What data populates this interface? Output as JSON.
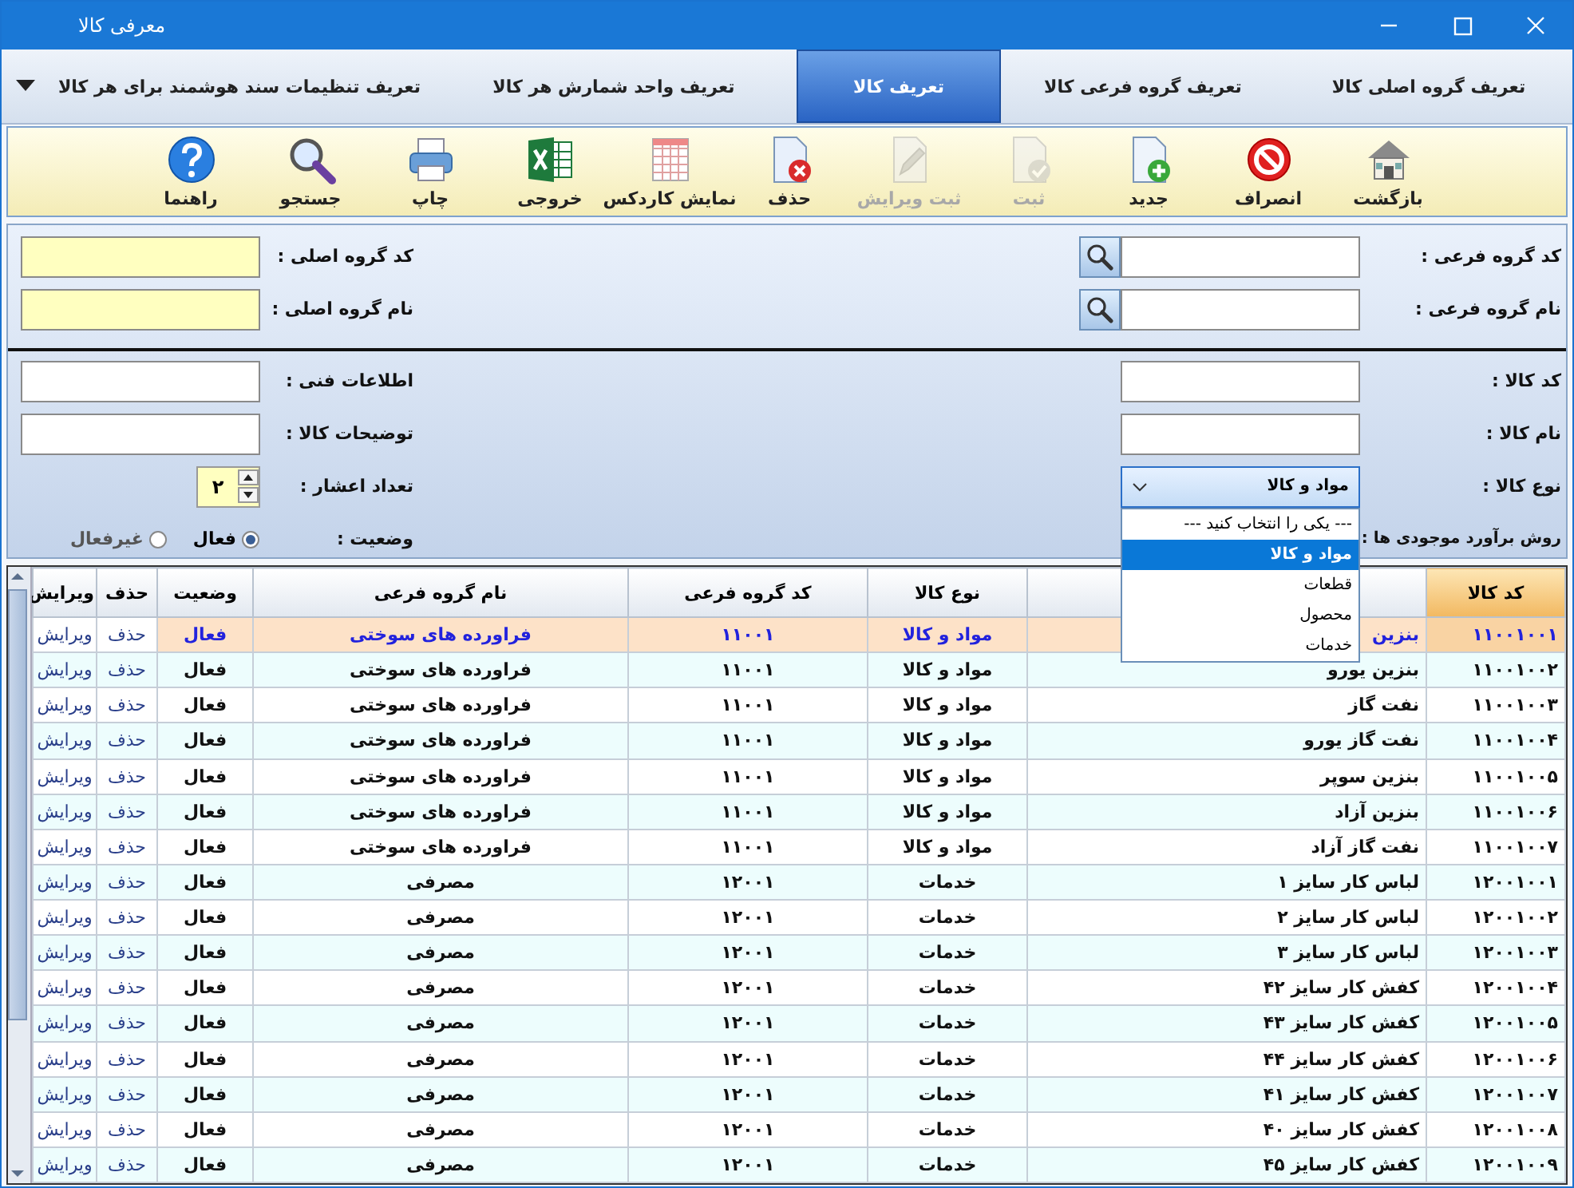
{
  "window": {
    "title": "معرفی کالا"
  },
  "tabs": [
    {
      "label": "تعریف گروه اصلی کالا",
      "selected": false
    },
    {
      "label": "تعریف گروه فرعی کالا",
      "selected": false
    },
    {
      "label": "تعریف کالا",
      "selected": true
    },
    {
      "label": "تعریف واحد شمارش هر کالا",
      "selected": false
    },
    {
      "label": "تعریف تنظیمات سند هوشمند برای هر کالا",
      "selected": false
    }
  ],
  "toolbar": [
    {
      "label": "بازگشت",
      "disabled": false
    },
    {
      "label": "انصراف",
      "disabled": false
    },
    {
      "label": "جدید",
      "disabled": false
    },
    {
      "label": "ثبت",
      "disabled": true
    },
    {
      "label": "ثبت ویرایش",
      "disabled": true
    },
    {
      "label": "حذف",
      "disabled": false
    },
    {
      "label": "نمایش کاردکس",
      "disabled": false
    },
    {
      "label": "خروجی",
      "disabled": false
    },
    {
      "label": "چاپ",
      "disabled": false
    },
    {
      "label": "جستجو",
      "disabled": false
    },
    {
      "label": "راهنما",
      "disabled": false
    }
  ],
  "group_section": {
    "sub_group": [
      {
        "label": "کد گروه فرعی :"
      },
      {
        "label": "نام گروه فرعی :"
      }
    ],
    "main_group": [
      {
        "label": "کد گروه اصلی :"
      },
      {
        "label": "نام گروه اصلی :"
      }
    ]
  },
  "item_section": {
    "right": [
      {
        "kind": "text",
        "label": "کد کالا :"
      },
      {
        "kind": "text",
        "label": "نام کالا :"
      },
      {
        "kind": "select",
        "label": "نوع کالا :",
        "value": "مواد و کالا",
        "expanded": true,
        "options": [
          {
            "label": "--- یکی را انتخاب کنید ---",
            "selected": false
          },
          {
            "label": "مواد و کالا",
            "selected": true
          },
          {
            "label": "قطعات",
            "selected": false
          },
          {
            "label": "محصول",
            "selected": false
          },
          {
            "label": "خدمات",
            "selected": false
          }
        ]
      },
      {
        "kind": "label",
        "label": "روش برآورد موجودی ها :"
      }
    ],
    "left": [
      {
        "kind": "text",
        "label": "اطلاعات فنی :"
      },
      {
        "kind": "text",
        "label": "توضیحات کالا :"
      },
      {
        "kind": "spinner",
        "label": "تعداد اعشار :",
        "value": "۲"
      },
      {
        "kind": "radio",
        "label": "وضعیت :",
        "options": [
          {
            "label": "فعال",
            "selected": true
          },
          {
            "label": "غیرفعال",
            "selected": false
          }
        ]
      }
    ]
  },
  "table": {
    "columns": [
      {
        "label": "کد کالا",
        "sorted": true
      },
      {
        "sorted": false
      },
      {
        "label": "نوع کالا",
        "sorted": false
      },
      {
        "label": "کد گروه فرعی",
        "sorted": false
      },
      {
        "label": "نام گروه فرعی",
        "sorted": false
      },
      {
        "label": "وضعیت",
        "sorted": false
      },
      {
        "label": "حذف",
        "sorted": false
      },
      {
        "label": "ویرایش",
        "sorted": false
      }
    ],
    "rows": [
      {
        "code": "۱۱۰۰۱۰۰۱",
        "name": "بنزین",
        "type": "مواد و کالا",
        "sub_code": "۱۱۰۰۱",
        "sub_name": "فراورده های سوختی",
        "status": "فعال",
        "delete": "حذف",
        "edit": "ویرایش",
        "selected": true
      },
      {
        "code": "۱۱۰۰۱۰۰۲",
        "name": "بنزین یورو",
        "type": "مواد و کالا",
        "sub_code": "۱۱۰۰۱",
        "sub_name": "فراورده های سوختی",
        "status": "فعال",
        "delete": "حذف",
        "edit": "ویرایش",
        "selected": false
      },
      {
        "code": "۱۱۰۰۱۰۰۳",
        "name": "نفت گاز",
        "type": "مواد و کالا",
        "sub_code": "۱۱۰۰۱",
        "sub_name": "فراورده های سوختی",
        "status": "فعال",
        "delete": "حذف",
        "edit": "ویرایش",
        "selected": false
      },
      {
        "code": "۱۱۰۰۱۰۰۴",
        "name": "نفت گاز یورو",
        "type": "مواد و کالا",
        "sub_code": "۱۱۰۰۱",
        "sub_name": "فراورده های سوختی",
        "status": "فعال",
        "delete": "حذف",
        "edit": "ویرایش",
        "selected": false
      },
      {
        "code": "۱۱۰۰۱۰۰۵",
        "name": "بنزین سوپر",
        "type": "مواد و کالا",
        "sub_code": "۱۱۰۰۱",
        "sub_name": "فراورده های سوختی",
        "status": "فعال",
        "delete": "حذف",
        "edit": "ویرایش",
        "selected": false
      },
      {
        "code": "۱۱۰۰۱۰۰۶",
        "name": "بنزین آزاد",
        "type": "مواد و کالا",
        "sub_code": "۱۱۰۰۱",
        "sub_name": "فراورده های سوختی",
        "status": "فعال",
        "delete": "حذف",
        "edit": "ویرایش",
        "selected": false
      },
      {
        "code": "۱۱۰۰۱۰۰۷",
        "name": "نفت گاز آزاد",
        "type": "مواد و کالا",
        "sub_code": "۱۱۰۰۱",
        "sub_name": "فراورده های سوختی",
        "status": "فعال",
        "delete": "حذف",
        "edit": "ویرایش",
        "selected": false
      },
      {
        "code": "۱۲۰۰۱۰۰۱",
        "name": "لباس کار سایز ۱",
        "type": "خدمات",
        "sub_code": "۱۲۰۰۱",
        "sub_name": "مصرفی",
        "status": "فعال",
        "delete": "حذف",
        "edit": "ویرایش",
        "selected": false
      },
      {
        "code": "۱۲۰۰۱۰۰۲",
        "name": "لباس کار سایز ۲",
        "type": "خدمات",
        "sub_code": "۱۲۰۰۱",
        "sub_name": "مصرفی",
        "status": "فعال",
        "delete": "حذف",
        "edit": "ویرایش",
        "selected": false
      },
      {
        "code": "۱۲۰۰۱۰۰۳",
        "name": "لباس کار سایز ۳",
        "type": "خدمات",
        "sub_code": "۱۲۰۰۱",
        "sub_name": "مصرفی",
        "status": "فعال",
        "delete": "حذف",
        "edit": "ویرایش",
        "selected": false
      },
      {
        "code": "۱۲۰۰۱۰۰۴",
        "name": "کفش کار سایز ۴۲",
        "type": "خدمات",
        "sub_code": "۱۲۰۰۱",
        "sub_name": "مصرفی",
        "status": "فعال",
        "delete": "حذف",
        "edit": "ویرایش",
        "selected": false
      },
      {
        "code": "۱۲۰۰۱۰۰۵",
        "name": "کفش کار سایز ۴۳",
        "type": "خدمات",
        "sub_code": "۱۲۰۰۱",
        "sub_name": "مصرفی",
        "status": "فعال",
        "delete": "حذف",
        "edit": "ویرایش",
        "selected": false
      },
      {
        "code": "۱۲۰۰۱۰۰۶",
        "name": "کفش کار سایز ۴۴",
        "type": "خدمات",
        "sub_code": "۱۲۰۰۱",
        "sub_name": "مصرفی",
        "status": "فعال",
        "delete": "حذف",
        "edit": "ویرایش",
        "selected": false
      },
      {
        "code": "۱۲۰۰۱۰۰۷",
        "name": "کفش کار سایز ۴۱",
        "type": "خدمات",
        "sub_code": "۱۲۰۰۱",
        "sub_name": "مصرفی",
        "status": "فعال",
        "delete": "حذف",
        "edit": "ویرایش",
        "selected": false
      },
      {
        "code": "۱۲۰۰۱۰۰۸",
        "name": "کفش کار سایز ۴۰",
        "type": "خدمات",
        "sub_code": "۱۲۰۰۱",
        "sub_name": "مصرفی",
        "status": "فعال",
        "delete": "حذف",
        "edit": "ویرایش",
        "selected": false
      },
      {
        "code": "۱۲۰۰۱۰۰۹",
        "name": "کفش کار سایز ۴۵",
        "type": "خدمات",
        "sub_code": "۱۲۰۰۱",
        "sub_name": "مصرفی",
        "status": "فعال",
        "delete": "حذف",
        "edit": "ویرایش",
        "selected": false
      }
    ]
  }
}
